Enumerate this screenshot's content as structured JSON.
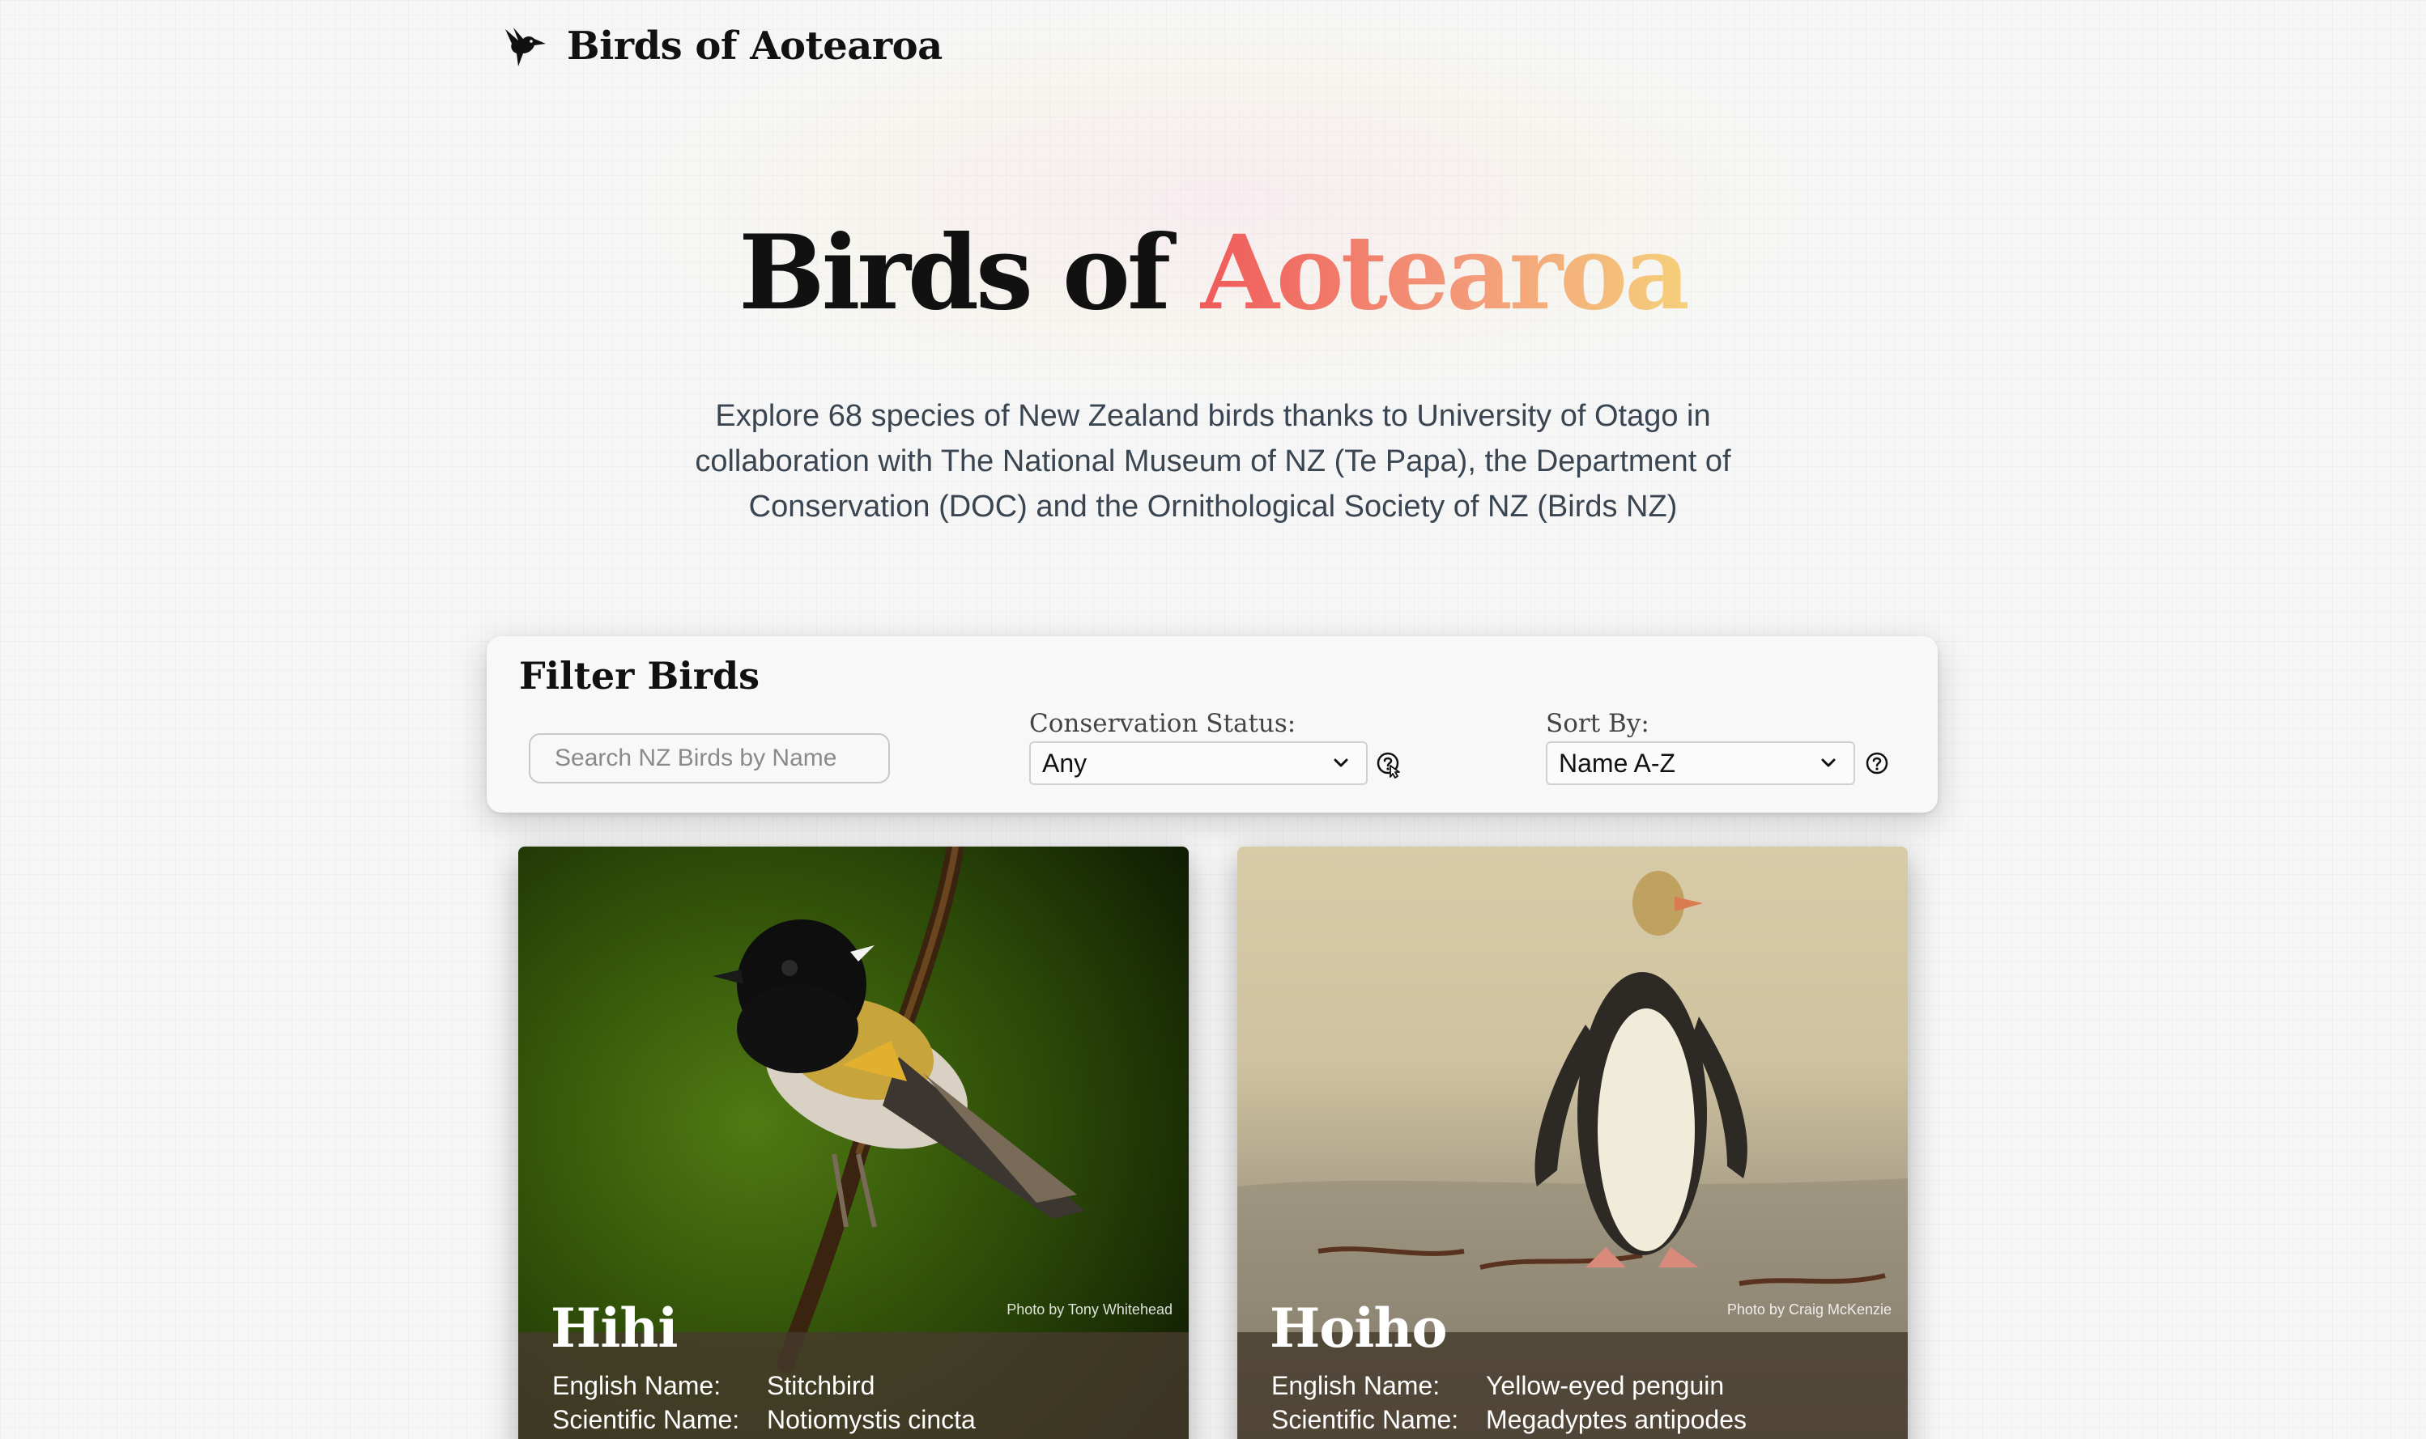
{
  "header": {
    "brand": "Birds of Aotearoa"
  },
  "hero": {
    "title_main": "Birds of ",
    "title_accent": "Aotearoa",
    "description": "Explore 68 species of New Zealand birds thanks to University of Otago in collaboration with The National Museum of NZ (Te Papa), the Department of Conservation (DOC) and the Ornithological Society of NZ (Birds NZ)"
  },
  "filter": {
    "title": "Filter Birds",
    "search_placeholder": "Search NZ Birds by Name",
    "conservation_label": "Conservation Status:",
    "conservation_value": "Any",
    "sort_label": "Sort By:",
    "sort_value": "Name A-Z"
  },
  "cards": [
    {
      "name": "Hihi",
      "credit": "Photo by Tony Whitehead",
      "english_label": "English Name:",
      "english_value": "Stitchbird",
      "scientific_label": "Scientific Name:",
      "scientific_value": "Notiomystis cincta"
    },
    {
      "name": "Hoiho",
      "credit": "Photo by Craig McKenzie",
      "english_label": "English Name:",
      "english_value": "Yellow-eyed penguin",
      "scientific_label": "Scientific Name:",
      "scientific_value": "Megadyptes antipodes"
    }
  ],
  "colors": {
    "accent_start": "#ef5a5a",
    "accent_end": "#f5d07a",
    "card_info_bg": "#463a2c"
  },
  "icons": {
    "logo": "hummingbird-icon",
    "chevron": "chevron-down-icon",
    "help": "question-circle-icon",
    "cursor": "hand-pointer-icon"
  }
}
